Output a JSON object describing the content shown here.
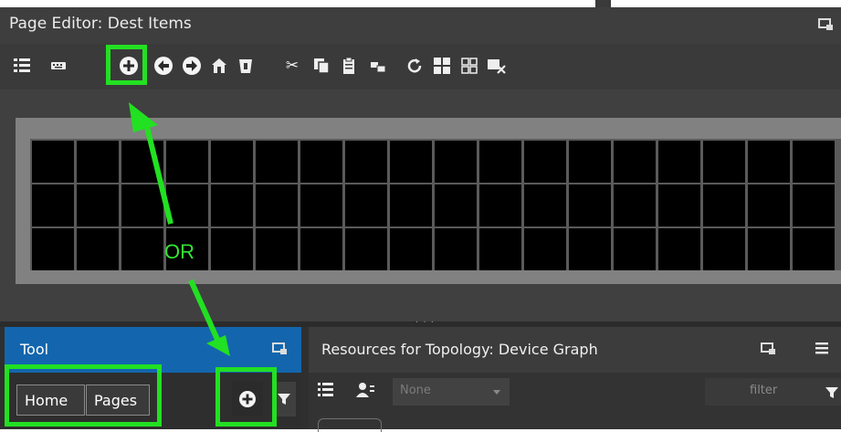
{
  "editor": {
    "title": "Page Editor: Dest Items",
    "toolbar_icons": [
      "list-icon",
      "keyboard-icon",
      "add-circle-icon",
      "arrow-left-icon",
      "arrow-right-icon",
      "home-icon",
      "trash-icon",
      "cut-icon",
      "copy-icon",
      "paste-icon",
      "move-icon",
      "refresh-icon",
      "grid-filled-icon",
      "grid-outline-icon",
      "delete-selection-icon"
    ]
  },
  "annotation": {
    "or_label": "OR",
    "highlight_color": "#22e022"
  },
  "tool_panel": {
    "title": "Tool",
    "breadcrumbs": [
      {
        "label": "Home"
      },
      {
        "label": "Pages"
      }
    ]
  },
  "resources_panel": {
    "title": "Resources for Topology: Device Graph",
    "select_placeholder": "None",
    "filter_placeholder": "filter"
  },
  "colors": {
    "tool_header": "#1366ad",
    "window_bg": "#3b3b3b",
    "grid_cell": "#000000"
  }
}
